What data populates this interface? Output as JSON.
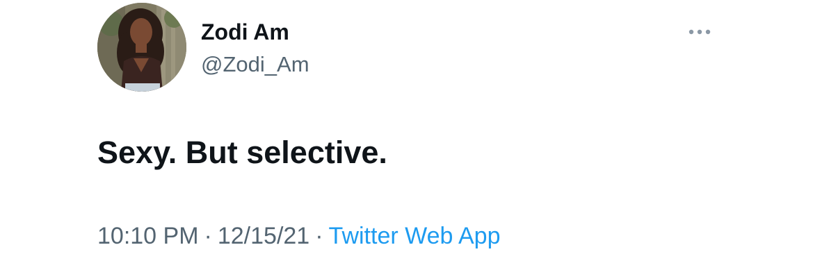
{
  "tweet": {
    "author": {
      "display_name": "Zodi Am",
      "handle": "@Zodi_Am"
    },
    "text": "Sexy. But selective.",
    "meta": {
      "time": "10:10 PM",
      "date": "12/15/21",
      "separator": "·",
      "source": "Twitter Web App"
    },
    "more_icon": "more-horizontal-icon",
    "avatar_icon": "profile-photo"
  },
  "colors": {
    "text_primary": "#0f1419",
    "text_secondary": "#536471",
    "link": "#1d9bf0",
    "icon_gray": "#8b98a5"
  }
}
